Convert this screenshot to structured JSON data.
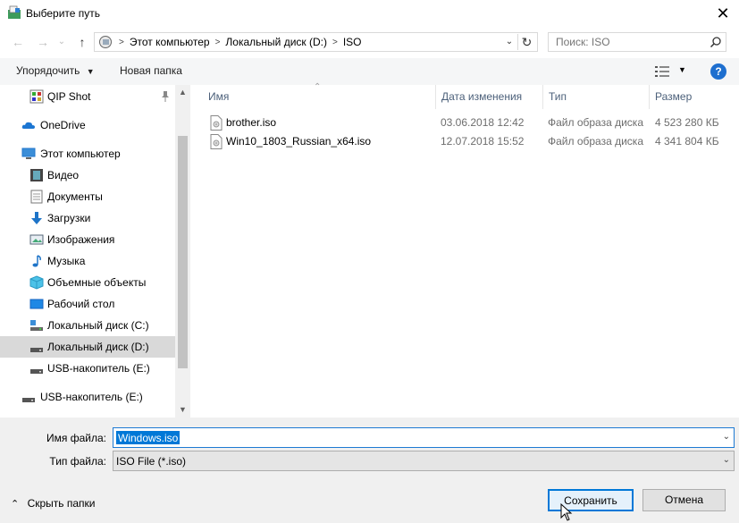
{
  "window": {
    "title": "Выберите путь",
    "close_glyph": "✕"
  },
  "navigation": {
    "back_glyph": "←",
    "forward_glyph": "→",
    "recent_glyph": "⌄",
    "up_glyph": "↑",
    "breadcrumbs": [
      "Этот компьютер",
      "Локальный диск (D:)",
      "ISO"
    ],
    "search_placeholder": "Поиск: ISO"
  },
  "toolbar": {
    "organize_label": "Упорядочить",
    "new_folder_label": "Новая папка",
    "help_glyph": "?"
  },
  "sidebar": {
    "items": [
      {
        "label": "QIP Shot",
        "icon": "qip-shot-icon",
        "pinned": true
      },
      {
        "label": "OneDrive",
        "icon": "onedrive-icon"
      },
      {
        "label": "Этот компьютер",
        "icon": "computer-icon"
      },
      {
        "label": "Видео",
        "icon": "video-icon"
      },
      {
        "label": "Документы",
        "icon": "documents-icon"
      },
      {
        "label": "Загрузки",
        "icon": "downloads-icon"
      },
      {
        "label": "Изображения",
        "icon": "pictures-icon"
      },
      {
        "label": "Музыка",
        "icon": "music-icon"
      },
      {
        "label": "Объемные объекты",
        "icon": "3d-objects-icon"
      },
      {
        "label": "Рабочий стол",
        "icon": "desktop-icon"
      },
      {
        "label": "Локальный диск (C:)",
        "icon": "drive-c-icon"
      },
      {
        "label": "Локальный диск (D:)",
        "icon": "drive-d-icon",
        "selected": true
      },
      {
        "label": "USB-накопитель (E:)",
        "icon": "usb-drive-icon"
      },
      {
        "label": "USB-накопитель (E:)",
        "icon": "usb-drive-icon"
      }
    ]
  },
  "file_list": {
    "columns": [
      "Имя",
      "Дата изменения",
      "Тип",
      "Размер"
    ],
    "rows": [
      {
        "name": "brother.iso",
        "date": "03.06.2018 12:42",
        "type": "Файл образа диска",
        "size": "4 523 280 КБ"
      },
      {
        "name": "Win10_1803_Russian_x64.iso",
        "date": "12.07.2018 15:52",
        "type": "Файл образа диска",
        "size": "4 341 804 КБ"
      }
    ]
  },
  "bottom": {
    "filename_label": "Имя файла:",
    "filename_value": "Windows.iso",
    "filetype_label": "Тип файла:",
    "filetype_value": "ISO File (*.iso)",
    "hide_folders_label": "Скрыть папки",
    "save_label": "Сохранить",
    "cancel_label": "Отмена"
  },
  "colors": {
    "accent": "#0078d7",
    "selection": "#d9d9d9",
    "help": "#1e6fcf"
  }
}
